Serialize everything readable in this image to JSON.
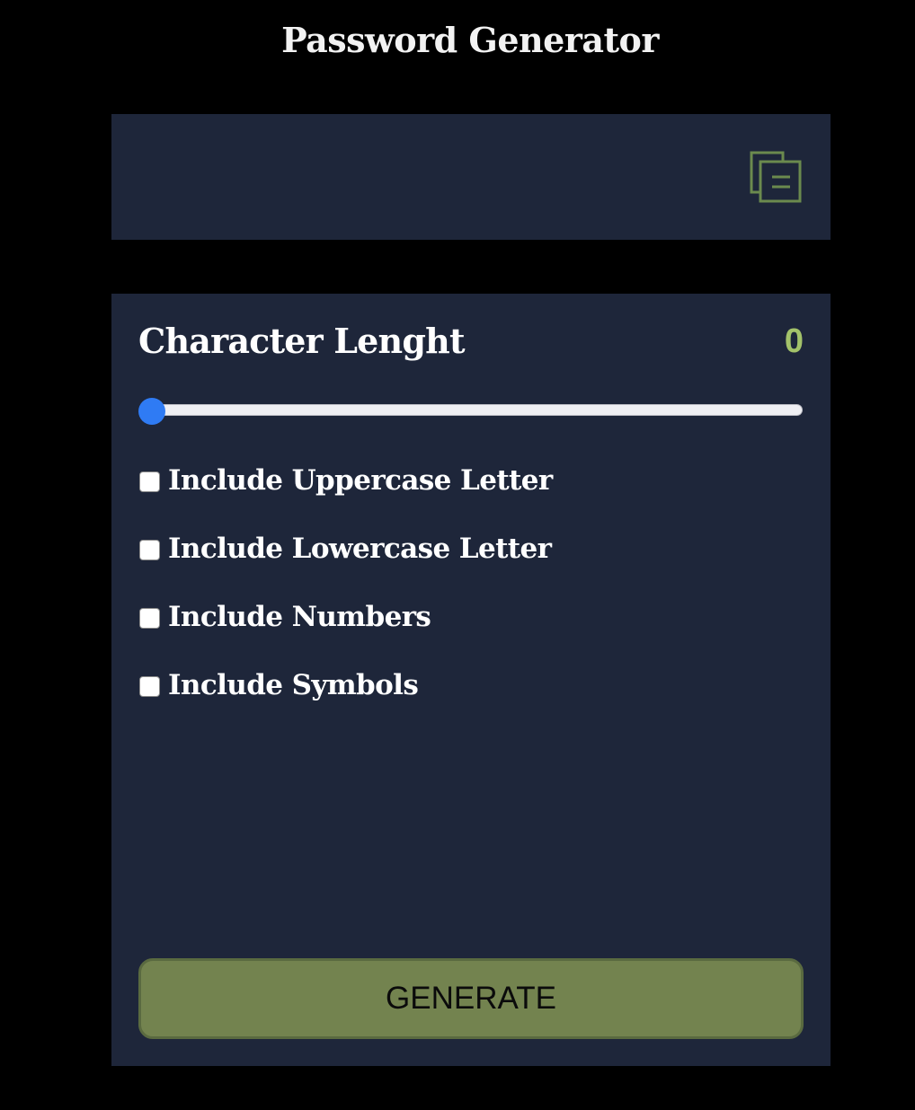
{
  "app": {
    "title": "Password Generator"
  },
  "output": {
    "password": "",
    "copy_icon": "copy-icon"
  },
  "length": {
    "label": "Character Lenght",
    "value": "0",
    "slider_fraction": 0
  },
  "options": [
    {
      "label": "Include Uppercase Letter",
      "checked": false
    },
    {
      "label": "Include Lowercase Letter",
      "checked": false
    },
    {
      "label": "Include Numbers",
      "checked": false
    },
    {
      "label": "Include Symbols",
      "checked": false
    }
  ],
  "generate": {
    "label": "GENERATE"
  },
  "colors": {
    "background": "#000000",
    "panel": "#1e263a",
    "accent_green": "#a3c26a",
    "button_green": "#73834f",
    "icon_green": "#6b8a4e",
    "slider_blue": "#2f7bf4"
  }
}
